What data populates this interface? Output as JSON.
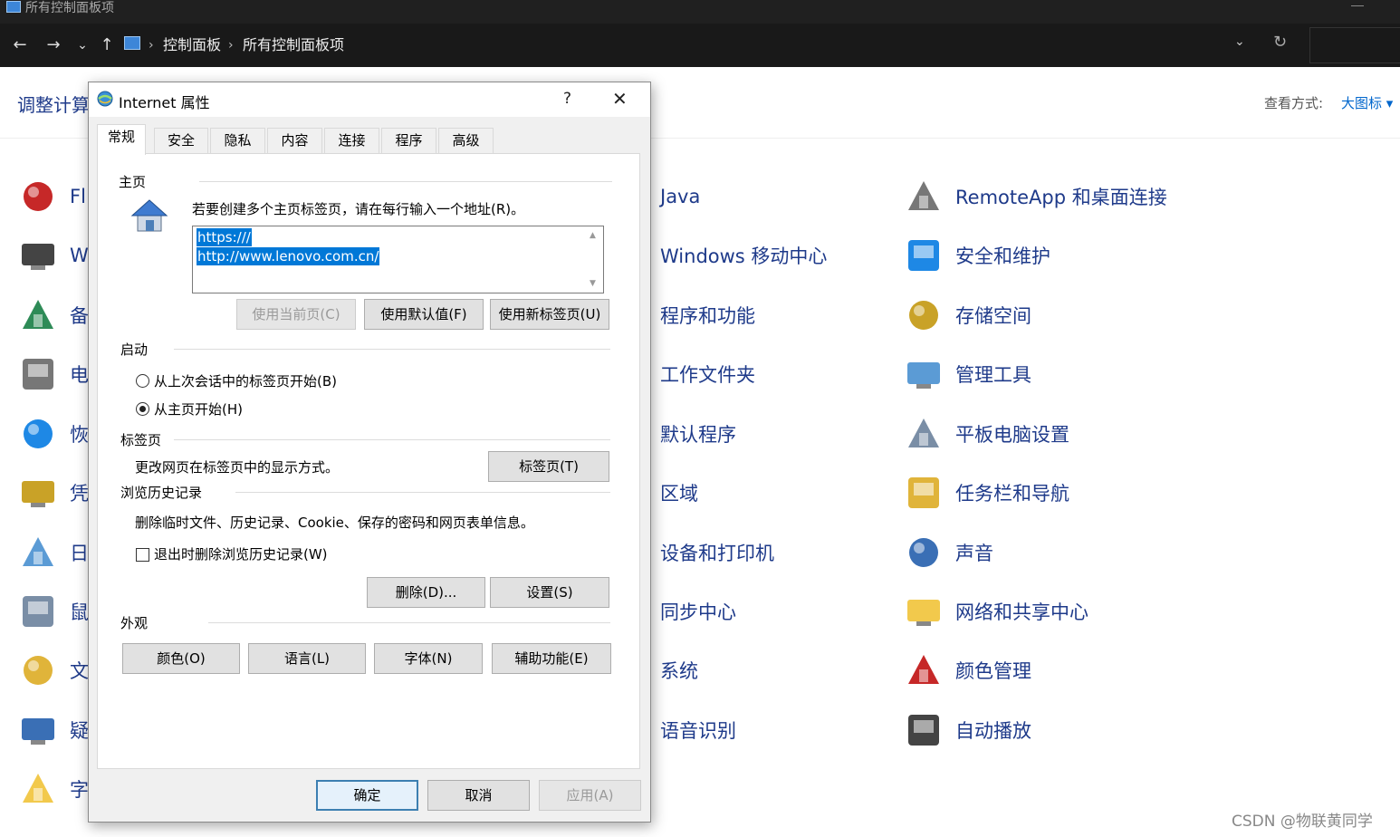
{
  "window": {
    "title": "所有控制面板项"
  },
  "addressbar": {
    "back_icon": "←",
    "forward_icon": "→",
    "recent_icon": "⌄",
    "up_icon": "↑",
    "breadcrumbs": [
      "控制面板",
      "所有控制面板项"
    ],
    "separator": "›",
    "dropdown_icon": "⌄",
    "refresh_icon": "↻"
  },
  "controlpanel": {
    "header_title": "调整计算",
    "view_label": "查看方式:",
    "view_value": "大图标 ▾",
    "left_column_labels": [
      "Fl",
      "W",
      "备",
      "电",
      "恢",
      "凭",
      "日",
      "鼠",
      "文",
      "疑",
      "字"
    ],
    "middle_column": [
      "Java",
      "Windows 移动中心",
      "程序和功能",
      "工作文件夹",
      "默认程序",
      "区域",
      "设备和打印机",
      "同步中心",
      "系统",
      "语音识别"
    ],
    "right_column": [
      "RemoteApp 和桌面连接",
      "安全和维护",
      "存储空间",
      "管理工具",
      "平板电脑设置",
      "任务栏和导航",
      "声音",
      "网络和共享中心",
      "颜色管理",
      "自动播放"
    ]
  },
  "dialog": {
    "title": "Internet 属性",
    "help_label": "?",
    "close_label": "✕",
    "tabs": [
      "常规",
      "安全",
      "隐私",
      "内容",
      "连接",
      "程序",
      "高级"
    ],
    "active_tab": "常规",
    "homepage": {
      "section_title": "主页",
      "instruction": "若要创建多个主页标签页，请在每行输入一个地址(R)。",
      "urls": [
        "https:///",
        "http://www.lenovo.com.cn/"
      ],
      "btn_use_current": "使用当前页(C)",
      "btn_use_default": "使用默认值(F)",
      "btn_use_new_tab": "使用新标签页(U)"
    },
    "startup": {
      "section_title": "启动",
      "option_last_session": "从上次会话中的标签页开始(B)",
      "option_homepage": "从主页开始(H)",
      "selected": "option_homepage"
    },
    "tabs_section": {
      "section_title": "标签页",
      "description": "更改网页在标签页中的显示方式。",
      "btn_tabs": "标签页(T)"
    },
    "history": {
      "section_title": "浏览历史记录",
      "description": "删除临时文件、历史记录、Cookie、保存的密码和网页表单信息。",
      "checkbox_label": "退出时删除浏览历史记录(W)",
      "checkbox_checked": false,
      "btn_delete": "删除(D)...",
      "btn_settings": "设置(S)"
    },
    "appearance": {
      "section_title": "外观",
      "btn_colors": "颜色(O)",
      "btn_languages": "语言(L)",
      "btn_fonts": "字体(N)",
      "btn_accessibility": "辅助功能(E)"
    },
    "footer": {
      "btn_ok": "确定",
      "btn_cancel": "取消",
      "btn_apply": "应用(A)"
    }
  },
  "watermark": "CSDN @物联黄同学",
  "colors": {
    "link_blue": "#1e3a8a",
    "selection_blue": "#0078d7",
    "titlebar_dark": "#202020"
  }
}
